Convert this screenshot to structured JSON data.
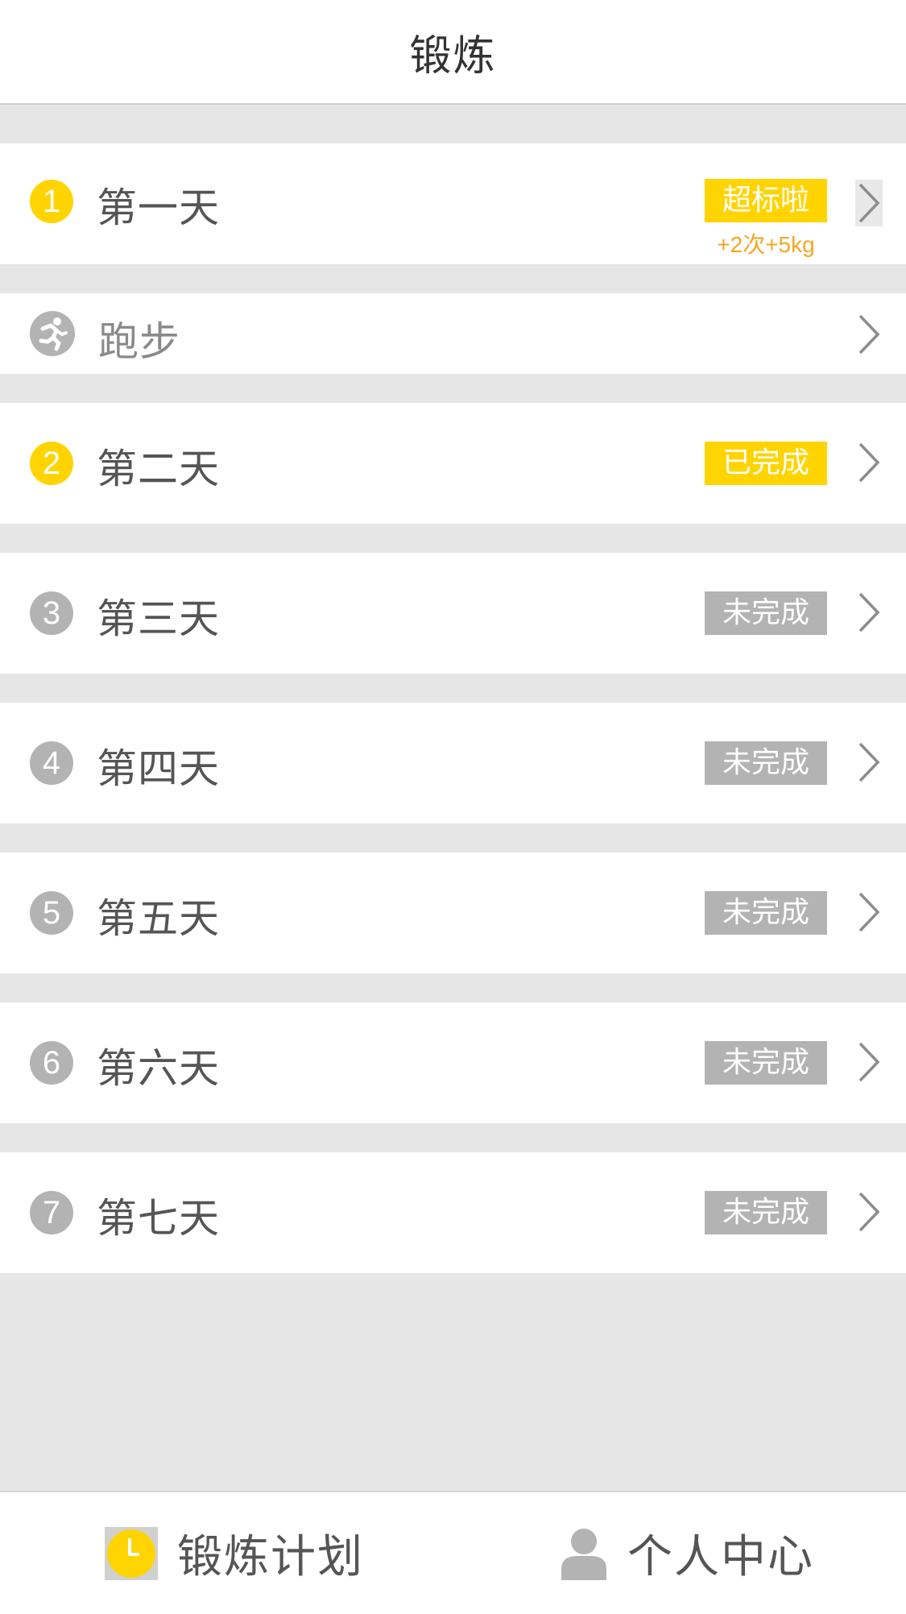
{
  "header": {
    "title": "锻炼"
  },
  "days": [
    {
      "number": "1",
      "label": "第一天",
      "status": "超标啦",
      "status_state": "exceeded",
      "extra": "+2次+5kg"
    },
    {
      "label": "跑步",
      "icon": "running-icon"
    },
    {
      "number": "2",
      "label": "第二天",
      "status": "已完成",
      "status_state": "done"
    },
    {
      "number": "3",
      "label": "第三天",
      "status": "未完成",
      "status_state": "pending"
    },
    {
      "number": "4",
      "label": "第四天",
      "status": "未完成",
      "status_state": "pending"
    },
    {
      "number": "5",
      "label": "第五天",
      "status": "未完成",
      "status_state": "pending"
    },
    {
      "number": "6",
      "label": "第六天",
      "status": "未完成",
      "status_state": "pending"
    },
    {
      "number": "7",
      "label": "第七天",
      "status": "未完成",
      "status_state": "pending"
    }
  ],
  "tabbar": {
    "plan": {
      "label": "锻炼计划",
      "icon": "clock-icon",
      "active": true
    },
    "profile": {
      "label": "个人中心",
      "icon": "user-icon",
      "active": false
    }
  },
  "colors": {
    "accent": "#ffd400",
    "accent_text": "#f5a623",
    "inactive": "#b3b3b3",
    "background": "#e6e6e6",
    "text": "#555555"
  }
}
